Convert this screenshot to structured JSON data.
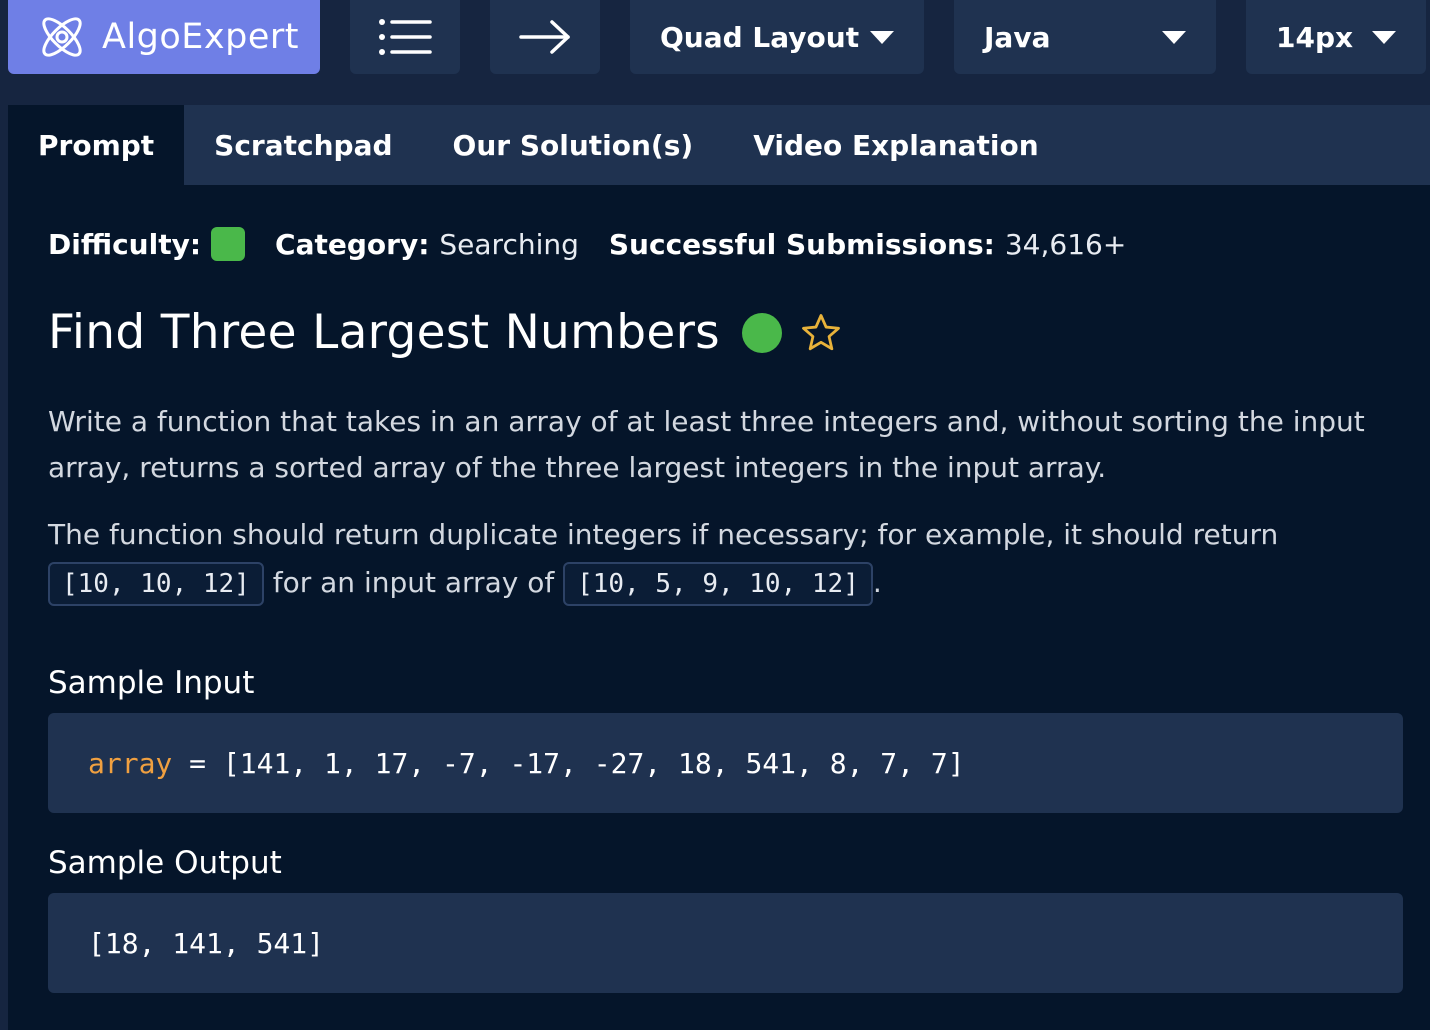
{
  "topbar": {
    "logo_text": "AlgoExpert",
    "layout_select": "Quad Layout",
    "language_select": "Java",
    "font_size_select": "14px"
  },
  "tabs": [
    "Prompt",
    "Scratchpad",
    "Our Solution(s)",
    "Video Explanation"
  ],
  "meta": {
    "difficulty_label": "Difficulty:",
    "category_label": "Category:",
    "category_value": "Searching",
    "submissions_label": "Successful Submissions:",
    "submissions_value": "34,616+"
  },
  "problem": {
    "title": "Find Three Largest Numbers",
    "para1": "Write a function that takes in an array of at least three integers and, without sorting the input array, returns a sorted array of the three largest integers in the input array.",
    "para2_a": "The function should return duplicate integers if necessary; for example, it should return",
    "code1": "[10, 10, 12]",
    "para2_b": " for an input array of ",
    "code2": "[10, 5, 9, 10, 12]",
    "para2_c": "."
  },
  "sample_input": {
    "heading": "Sample Input",
    "var": "array",
    "rest": " = [141, 1, 17, -7, -17, -27, 18, 541, 8, 7, 7]"
  },
  "sample_output": {
    "heading": "Sample Output",
    "value": "[18, 141, 541]"
  },
  "colors": {
    "accent": "#6f7fe6",
    "easy_green": "#4ab84a",
    "keyword_orange": "#f0a040",
    "star_gold": "#e8b23a"
  }
}
